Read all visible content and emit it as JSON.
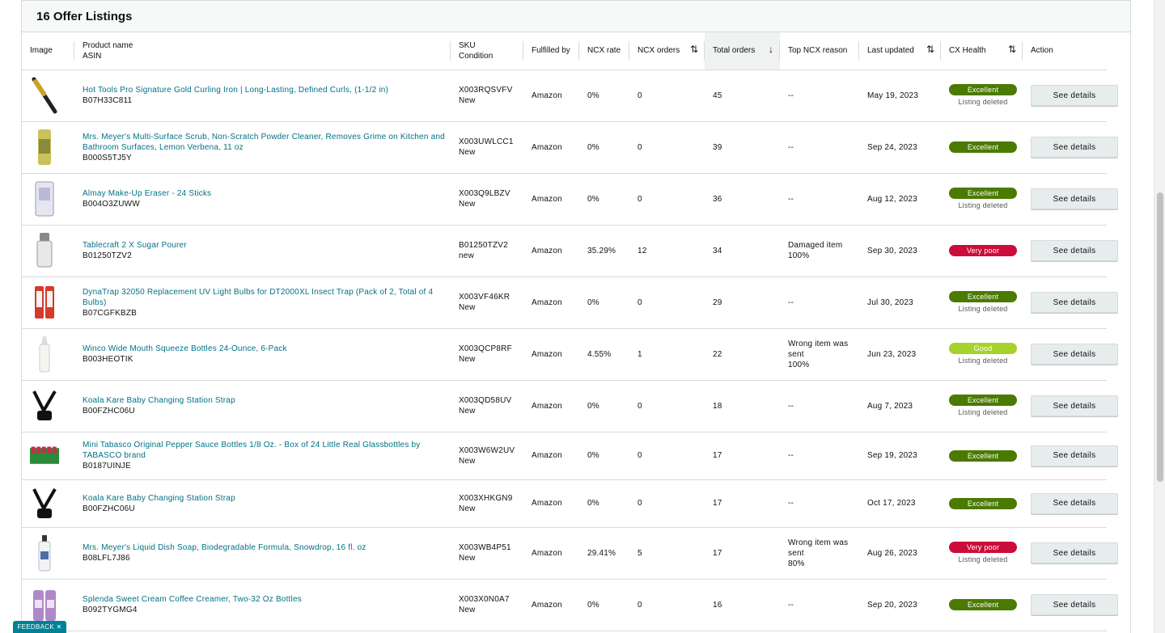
{
  "panel": {
    "title": "16 Offer Listings"
  },
  "columns": {
    "image": "Image",
    "product_name": "Product name",
    "asin": "ASIN",
    "sku": "SKU",
    "condition": "Condition",
    "fulfilled_by": "Fulfilled by",
    "ncx_rate": "NCX rate",
    "ncx_orders": "NCX orders",
    "total_orders": "Total orders",
    "top_ncx_reason": "Top NCX reason",
    "last_updated": "Last updated",
    "cx_health": "CX Health",
    "action": "Action"
  },
  "sort": {
    "sortable_icon": "⇅",
    "sorted_desc_icon": "↓"
  },
  "rows": [
    {
      "name": "Hot Tools Pro Signature Gold Curling Iron | Long-Lasting, Defined Curls, (1-1/2 in)",
      "asin": "B07H33C811",
      "sku": "X003RQSVFV",
      "condition": "New",
      "fulfilled": "Amazon",
      "ncx_rate": "0%",
      "ncx_orders": "0",
      "total": "45",
      "reason": "--",
      "reason_pct": "",
      "updated": "May 19, 2023",
      "health": "Excellent",
      "health_class": "excellent",
      "status": "Listing deleted",
      "action": "See details",
      "icon": "curling-iron-icon"
    },
    {
      "name": "Mrs. Meyer's Multi-Surface Scrub, Non-Scratch Powder Cleaner, Removes Grime on Kitchen and Bathroom Surfaces, Lemon Verbena, 11 oz",
      "asin": "B000S5TJ5Y",
      "sku": "X003UWLCC1",
      "condition": "New",
      "fulfilled": "Amazon",
      "ncx_rate": "0%",
      "ncx_orders": "0",
      "total": "39",
      "reason": "--",
      "reason_pct": "",
      "updated": "Sep 24, 2023",
      "health": "Excellent",
      "health_class": "excellent",
      "status": "",
      "action": "See details",
      "icon": "cleaner-can-icon"
    },
    {
      "name": "Almay Make-Up Eraser - 24 Sticks",
      "asin": "B004O3ZUWW",
      "sku": "X003Q9LBZV",
      "condition": "New",
      "fulfilled": "Amazon",
      "ncx_rate": "0%",
      "ncx_orders": "0",
      "total": "36",
      "reason": "--",
      "reason_pct": "",
      "updated": "Aug 12, 2023",
      "health": "Excellent",
      "health_class": "excellent",
      "status": "Listing deleted",
      "action": "See details",
      "icon": "makeup-eraser-icon"
    },
    {
      "name": "Tablecraft 2 X Sugar Pourer",
      "asin": "B01250TZV2",
      "sku": "B01250TZV2",
      "condition": "new",
      "fulfilled": "Amazon",
      "ncx_rate": "35.29%",
      "ncx_orders": "12",
      "total": "34",
      "reason": "Damaged item",
      "reason_pct": "100%",
      "updated": "Sep 30, 2023",
      "health": "Very poor",
      "health_class": "poor",
      "status": "",
      "action": "See details",
      "icon": "sugar-pourer-icon"
    },
    {
      "name": "DynaTrap 32050 Replacement UV Light Bulbs for DT2000XL Insect Trap (Pack of 2, Total of 4 Bulbs)",
      "asin": "B07CGFKBZB",
      "sku": "X003VF46KR",
      "condition": "New",
      "fulfilled": "Amazon",
      "ncx_rate": "0%",
      "ncx_orders": "0",
      "total": "29",
      "reason": "--",
      "reason_pct": "",
      "updated": "Jul 30, 2023",
      "health": "Excellent",
      "health_class": "excellent",
      "status": "Listing deleted",
      "action": "See details",
      "icon": "uv-bulbs-icon"
    },
    {
      "name": "Winco Wide Mouth Squeeze Bottles 24-Ounce, 6-Pack",
      "asin": "B003HEOTIK",
      "sku": "X003QCP8RF",
      "condition": "New",
      "fulfilled": "Amazon",
      "ncx_rate": "4.55%",
      "ncx_orders": "1",
      "total": "22",
      "reason": "Wrong item was sent",
      "reason_pct": "100%",
      "updated": "Jun 23, 2023",
      "health": "Good",
      "health_class": "good",
      "status": "Listing deleted",
      "action": "See details",
      "icon": "squeeze-bottle-icon"
    },
    {
      "name": "Koala Kare Baby Changing Station Strap",
      "asin": "B00FZHC06U",
      "sku": "X003QD58UV",
      "condition": "New",
      "fulfilled": "Amazon",
      "ncx_rate": "0%",
      "ncx_orders": "0",
      "total": "18",
      "reason": "--",
      "reason_pct": "",
      "updated": "Aug 7, 2023",
      "health": "Excellent",
      "health_class": "excellent",
      "status": "Listing deleted",
      "action": "See details",
      "icon": "strap-icon"
    },
    {
      "name": "Mini Tabasco Original Pepper Sauce Bottles 1/8 Oz. - Box of 24 Little Real Glassbottles by TABASCO brand",
      "asin": "B0187UINJE",
      "sku": "X003W6W2UV",
      "condition": "New",
      "fulfilled": "Amazon",
      "ncx_rate": "0%",
      "ncx_orders": "0",
      "total": "17",
      "reason": "--",
      "reason_pct": "",
      "updated": "Sep 19, 2023",
      "health": "Excellent",
      "health_class": "excellent",
      "status": "",
      "action": "See details",
      "icon": "tabasco-box-icon"
    },
    {
      "name": "Koala Kare Baby Changing Station Strap",
      "asin": "B00FZHC06U",
      "sku": "X003XHKGN9",
      "condition": "New",
      "fulfilled": "Amazon",
      "ncx_rate": "0%",
      "ncx_orders": "0",
      "total": "17",
      "reason": "--",
      "reason_pct": "",
      "updated": "Oct 17, 2023",
      "health": "Excellent",
      "health_class": "excellent",
      "status": "",
      "action": "See details",
      "icon": "strap-icon"
    },
    {
      "name": "Mrs. Meyer's Liquid Dish Soap, Biodegradable Formula, Snowdrop, 16 fl. oz",
      "asin": "B08LFL7J86",
      "sku": "X003WB4P51",
      "condition": "New",
      "fulfilled": "Amazon",
      "ncx_rate": "29.41%",
      "ncx_orders": "5",
      "total": "17",
      "reason": "Wrong item was sent",
      "reason_pct": "80%",
      "updated": "Aug 26, 2023",
      "health": "Very poor",
      "health_class": "poor",
      "status": "Listing deleted",
      "action": "See details",
      "icon": "dish-soap-icon"
    },
    {
      "name": "Splenda Sweet Cream Coffee Creamer, Two-32 Oz Bottles",
      "asin": "B092TYGMG4",
      "sku": "X003X0N0A7",
      "condition": "New",
      "fulfilled": "Amazon",
      "ncx_rate": "0%",
      "ncx_orders": "0",
      "total": "16",
      "reason": "--",
      "reason_pct": "",
      "updated": "Sep 20, 2023",
      "health": "Excellent",
      "health_class": "excellent",
      "status": "",
      "action": "See details",
      "icon": "creamer-bottles-icon"
    }
  ],
  "feedback": {
    "label": "FEEDBACK ✕"
  }
}
